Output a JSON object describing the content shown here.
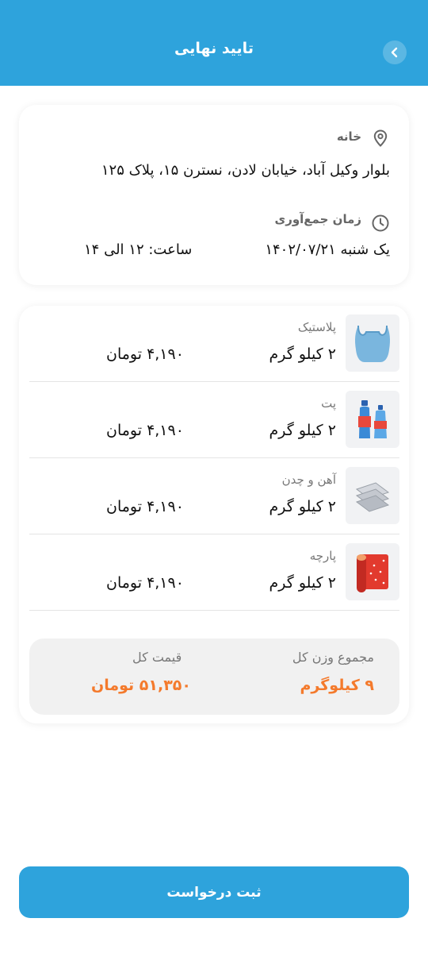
{
  "header": {
    "title": "تایید نهایی",
    "back_icon": "chevron-left-icon"
  },
  "address": {
    "label": "خانه",
    "text": "بلوار وکیل آباد، خیابان لادن، نسترن ۱۵، پلاک ۱۲۵",
    "icon": "location-pin-icon"
  },
  "pickup": {
    "label": "زمان جمع‌آوری",
    "date": "یک شنبه  ۱۴۰۲/۰۷/۲۱",
    "time": "ساعت:  ۱۲ الی ۱۴",
    "icon": "clock-icon"
  },
  "items": [
    {
      "name": "پلاستیک",
      "weight": "۲ کیلو گرم",
      "price": "۴,۱۹۰ تومان",
      "icon": "plastic-bag-icon"
    },
    {
      "name": "پت",
      "weight": "۲ کیلو گرم",
      "price": "۴,۱۹۰ تومان",
      "icon": "pet-bottles-icon"
    },
    {
      "name": "آهن و چدن",
      "weight": "۲ کیلو گرم",
      "price": "۴,۱۹۰ تومان",
      "icon": "metal-bars-icon"
    },
    {
      "name": "پارچه",
      "weight": "۲ کیلو گرم",
      "price": "۴,۱۹۰ تومان",
      "icon": "fabric-roll-icon"
    }
  ],
  "summary": {
    "weight_label": "مجموع وزن کل",
    "weight_value": "۹ کیلوگرم",
    "price_label": "قیمت کل",
    "price_value": "۵۱,۳۵۰ تومان",
    "accent_color": "#f47a2c"
  },
  "submit": {
    "label": "ثبت درخواست"
  },
  "colors": {
    "primary": "#2ea3dc",
    "accent": "#f47a2c"
  }
}
